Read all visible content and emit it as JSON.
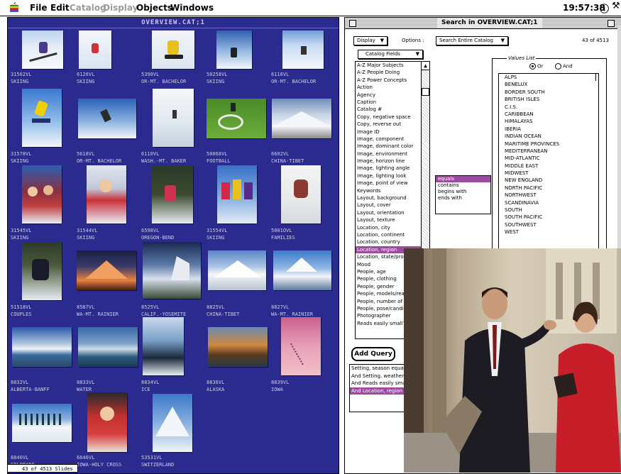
{
  "menubar": {
    "apple": "",
    "items": [
      {
        "label": "File",
        "enabled": true
      },
      {
        "label": "Edit",
        "enabled": true
      },
      {
        "label": "Catalog",
        "enabled": false
      },
      {
        "label": "Display",
        "enabled": false
      },
      {
        "label": "Objects",
        "enabled": true
      },
      {
        "label": "Windows",
        "enabled": true
      }
    ],
    "clock": "19:57:38"
  },
  "catalog_window": {
    "title": "OVERVIEW.CAT;1",
    "slide_count": "43 of 4513 Slides",
    "thumbnails": [
      {
        "id": "31562VL",
        "caption": "SKIING"
      },
      {
        "id": "6126VL",
        "caption": "SKIING"
      },
      {
        "id": "5390VL",
        "caption": "OR-MT. BACHELOR"
      },
      {
        "id": "50258VL",
        "caption": "SKIING"
      },
      {
        "id": "6116VL",
        "caption": "OR-MT. BACHELOR"
      },
      {
        "id": "31578VL",
        "caption": "SKIING"
      },
      {
        "id": "5618VL",
        "caption": "OR-MT. BACHELOR"
      },
      {
        "id": "6110VL",
        "caption": "WASH.-MT. BAKER"
      },
      {
        "id": "50068VL",
        "caption": "FOOTBALL"
      },
      {
        "id": "6602VL",
        "caption": "CHINA-TIBET"
      },
      {
        "id": "31545VL",
        "caption": "SKIING"
      },
      {
        "id": "31544VL",
        "caption": "SKIING"
      },
      {
        "id": "6598VL",
        "caption": "OREGON-BEND"
      },
      {
        "id": "31554VL",
        "caption": "SKIING"
      },
      {
        "id": "5001OVL",
        "caption": "FAMILIES"
      },
      {
        "id": "51518VL",
        "caption": "COUPLES"
      },
      {
        "id": "8587VL",
        "caption": "WA-MT. RAINIER"
      },
      {
        "id": "8525VL",
        "caption": "CALIF.-YOSEMITE"
      },
      {
        "id": "8825VL",
        "caption": "CHINA-TIBET"
      },
      {
        "id": "8827VL",
        "caption": "WA-MT. RAINIER"
      },
      {
        "id": "8832VL",
        "caption": "ALBERTA-BANFF"
      },
      {
        "id": "8833VL",
        "caption": "WATER"
      },
      {
        "id": "8834VL",
        "caption": "ICE"
      },
      {
        "id": "8836VL",
        "caption": "ALASKA"
      },
      {
        "id": "8839VL",
        "caption": "IOWA"
      },
      {
        "id": "8840VL",
        "caption": "COLORADO"
      },
      {
        "id": "6646VL",
        "caption": "IOWA-HOLY CROSS"
      },
      {
        "id": "53531VL",
        "caption": "SWITZERLAND"
      }
    ]
  },
  "search_window": {
    "title": "Search in OVERVIEW.CAT;1",
    "display_popup": "Display",
    "options_label": "Options :",
    "options_popup": "Search Entire Catalog",
    "result_count": "43 of 4513",
    "fields_popup": "Catalog Fields",
    "fields": [
      "A-Z Major Subjects",
      "A-Z People Doing",
      "A-Z Power Concepts",
      "Action",
      "Agency",
      "Caption",
      "Catalog #",
      "Copy, negative space",
      "Copy, reverse out",
      "Image ID",
      "Image, component",
      "Image, dominant color",
      "Image, environment",
      "Image, horizon line",
      "Image, lighting angle",
      "Image, lighting look",
      "Image, point of view",
      "Keywords",
      "Layout, background",
      "Layout, cover",
      "Layout, orientation",
      "Layout, texture",
      "Location, city",
      "Location, continent",
      "Location, country",
      "Location, region",
      "Location, state/pro",
      "Mood",
      "People, age",
      "People, clothing",
      "People, gender",
      "People, models/rea",
      "People, number of",
      "People, pose/candid",
      "Photographer",
      "Reads easily small?"
    ],
    "selected_field": "Location, region",
    "operators": [
      "equals",
      "contains",
      "begins with",
      "ends with"
    ],
    "selected_operator": "equals",
    "values_header": "Values List",
    "radio_or": "Or",
    "radio_and": "And",
    "values": [
      "ALPS",
      "BENELUX",
      "BORDER SOUTH",
      "BRITISH ISLES",
      "C.I.S.",
      "CARIBBEAN",
      "HIMALAYAS",
      "IBERIA",
      "INDIAN OCEAN",
      "MARITIME PROVINCES",
      "MEDITERRANEAN",
      "MID-ATLANTIC",
      "MIDDLE EAST",
      "MIDWEST",
      "NEW ENGLAND",
      "NORTH PACIFIC",
      "NORTHWEST",
      "SCANDINAVIA",
      "SOUTH",
      "SOUTH PACIFIC",
      "SOUTHWEST",
      "WEST"
    ],
    "add_query_label": "Add Query",
    "queries": [
      "Setting, season equal",
      "And  Setting, weather",
      "And  Reads easily sma",
      "And  Location, region"
    ]
  },
  "colors": {
    "catalog_bg": "#2b2a8e",
    "highlight": "#9b4c9e"
  }
}
